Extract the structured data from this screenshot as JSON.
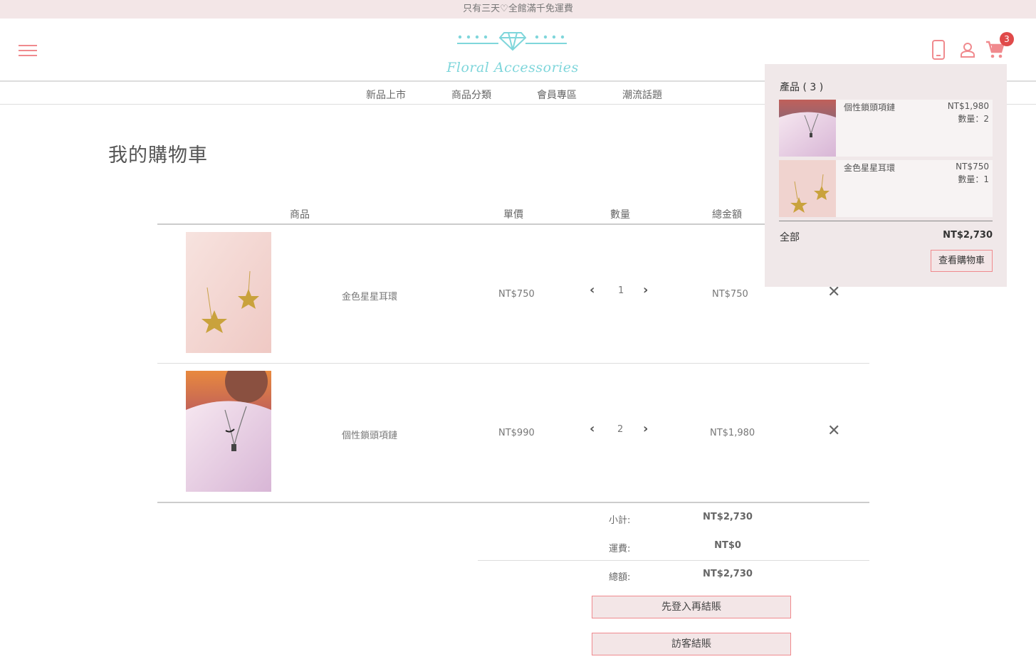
{
  "announcement": "只有三天♡全館滿千免運費",
  "brand": {
    "name": "Floral Accessories",
    "accent": "#7fd6db",
    "pink": "#f08a8e"
  },
  "nav": [
    "新品上市",
    "商品分類",
    "會員專區",
    "潮流話題"
  ],
  "header": {
    "cart_count": "3"
  },
  "page_title": "我的購物車",
  "table_headers": {
    "product": "商品",
    "unit_price": "單價",
    "quantity": "數量",
    "total": "總金額"
  },
  "cart_rows": [
    {
      "name": "金色星星耳環",
      "unit_price": "NT$750",
      "qty": "1",
      "total": "NT$750",
      "image": "gold-star-earrings"
    },
    {
      "name": "個性鎖頭項鏈",
      "unit_price": "NT$990",
      "qty": "2",
      "total": "NT$1,980",
      "image": "lock-pendant-necklace"
    }
  ],
  "summary": {
    "subtotal_label": "小計:",
    "subtotal": "NT$2,730",
    "shipping_label": "運費:",
    "shipping": "NT$0",
    "total_label": "總額:",
    "total": "NT$2,730"
  },
  "buttons": {
    "login_checkout": "先登入再結賬",
    "guest_checkout": "訪客結賬"
  },
  "mini_cart": {
    "title": "產品 ( 3 )",
    "items": [
      {
        "name": "個性鎖頭項鏈",
        "price": "NT$1,980",
        "qty": "數量：2"
      },
      {
        "name": "金色星星耳環",
        "price": "NT$750",
        "qty": "數量：1"
      }
    ],
    "total_label": "全部",
    "total": "NT$2,730",
    "view_cart": "查看購物車"
  }
}
